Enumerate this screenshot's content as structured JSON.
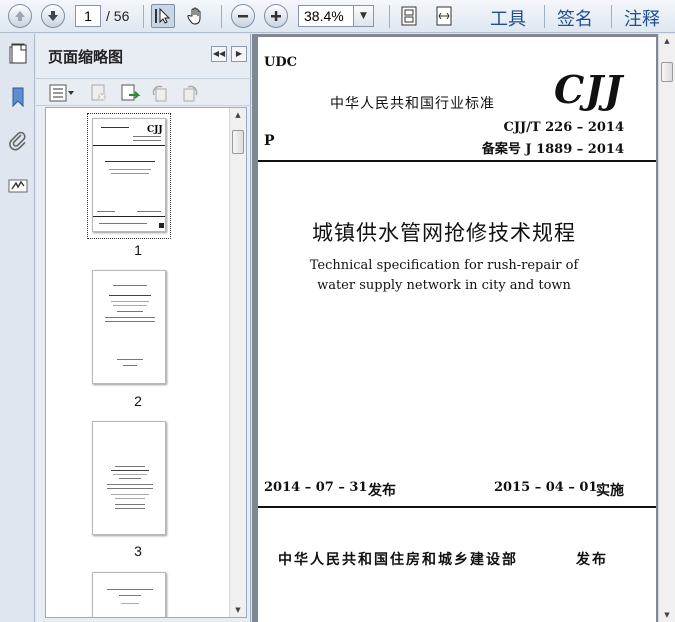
{
  "toolbar": {
    "current_page": "1",
    "total_pages": "/ 56",
    "zoom": "38.4%",
    "menu_tools": "工具",
    "menu_sign": "签名",
    "menu_comment": "注释"
  },
  "panel": {
    "title": "页面缩略图",
    "thumbnails": [
      {
        "page": "1"
      },
      {
        "page": "2"
      },
      {
        "page": "3"
      }
    ]
  },
  "document": {
    "udc": "UDC",
    "industry_standard": "中华人民共和国行业标准",
    "logo": "CJJ",
    "p_label": "P",
    "std_number": "CJJ/T 226 – 2014",
    "record_number": "备案号 J 1889 – 2014",
    "title_cn": "城镇供水管网抢修技术规程",
    "title_en_line1": "Technical specification for rush-repair of",
    "title_en_line2": "water supply network in city and town",
    "issue_date": "2014 – 07 – 31",
    "issue_word": "发布",
    "effective_date": "2015 – 04 – 01",
    "effective_word": "实施",
    "publisher": "中华人民共和国住房和城乡建设部",
    "publisher_word": "发布"
  },
  "colors": {
    "menu_text": "#1f4f8f",
    "doc_background": "#7f8790",
    "panel_background": "#e8edf4"
  }
}
